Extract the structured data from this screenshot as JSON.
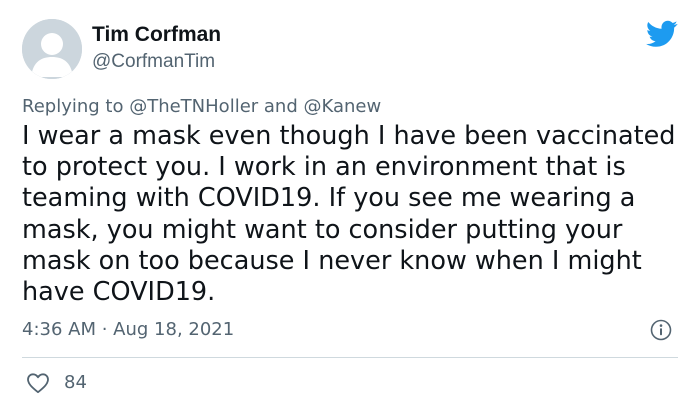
{
  "author": {
    "name": "Tim Corfman",
    "handle": "@CorfmanTim"
  },
  "reply": {
    "prefix": "Replying to ",
    "mention1": "@TheTNHoller",
    "conjunction": " and ",
    "mention2": "@Kanew"
  },
  "tweet": {
    "text": "I wear a mask even though I have been vaccinated\nto protect you.  I work in an environment that is\nteaming with COVID19.  If you see me wearing a\nmask, you might want to consider putting your\nmask on too because I never know when I might\nhave COVID19.",
    "time": "4:36 AM",
    "separator": " · ",
    "date": "Aug 18, 2021"
  },
  "engagement": {
    "likes": "84"
  },
  "icons": {
    "brand": "twitter-bird-icon",
    "info": "info-icon",
    "like": "heart-icon"
  },
  "colors": {
    "brand": "#1d9bf0",
    "secondary_text": "#536471",
    "primary_text": "#0f1419",
    "avatar_placeholder": "#ccd6dd"
  }
}
